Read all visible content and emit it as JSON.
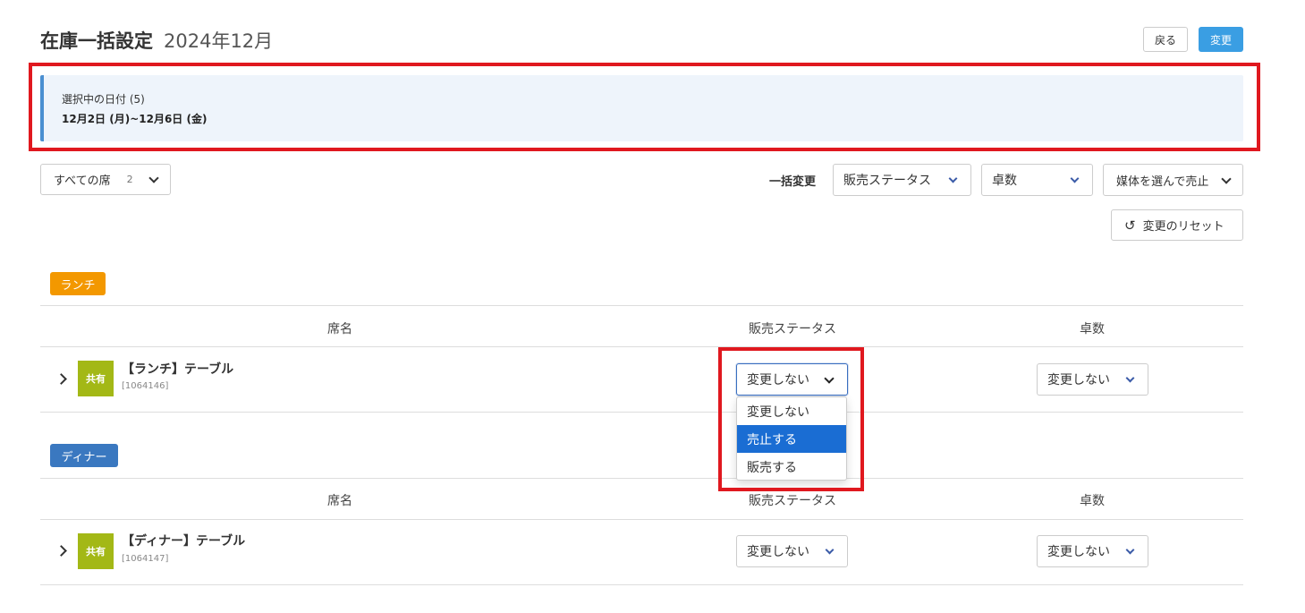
{
  "header": {
    "title": "在庫一括設定",
    "month": "2024年12月",
    "back_label": "戻る",
    "change_label": "変更"
  },
  "selection": {
    "label": "選択中の日付 (5)",
    "range": "12月2日 (月)~12月6日 (金)"
  },
  "filters": {
    "seat_filter_label": "すべての席",
    "seat_filter_count": "2",
    "bulk_label": "一括変更",
    "status_label": "販売ステータス",
    "tables_label": "卓数",
    "media_label": "媒体を選んで売止",
    "reset_label": "変更のリセット"
  },
  "sections": [
    {
      "tag": "ランチ",
      "columns": {
        "name": "席名",
        "status": "販売ステータス",
        "tables": "卓数"
      },
      "rows": [
        {
          "badge": "共有",
          "name": "【ランチ】テーブル",
          "id": "[1064146]",
          "status": "変更しない",
          "tables": "変更しない"
        }
      ]
    },
    {
      "tag": "ディナー",
      "columns": {
        "name": "席名",
        "status": "販売ステータス",
        "tables": "卓数"
      },
      "rows": [
        {
          "badge": "共有",
          "name": "【ディナー】テーブル",
          "id": "[1064147]",
          "status": "変更しない",
          "tables": "変更しない"
        }
      ]
    }
  ],
  "status_menu": {
    "options": [
      "変更しない",
      "売止する",
      "販売する"
    ],
    "highlighted": "売止する"
  },
  "colors": {
    "primary": "#3a9ee3",
    "lunch_tag": "#f39800",
    "dinner_tag": "#3a78c0",
    "shared_badge": "#a3b816",
    "highlight": "#e0181f",
    "menu_active": "#1a6dd3"
  }
}
